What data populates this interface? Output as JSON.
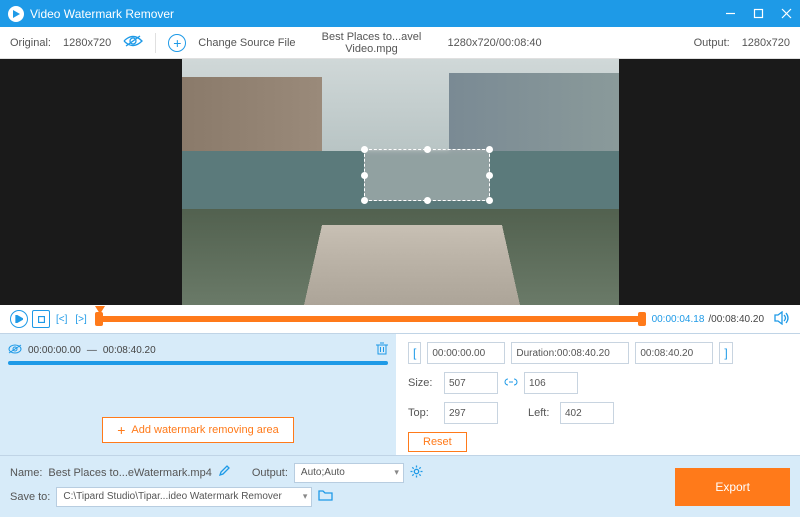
{
  "app": {
    "title": "Video Watermark Remover"
  },
  "toolbar": {
    "original_label": "Original:",
    "original_res": "1280x720",
    "change_source": "Change Source File",
    "filename": "Best Places to...avel Video.mpg",
    "file_meta": "1280x720/00:08:40",
    "output_label": "Output:",
    "output_res": "1280x720"
  },
  "timeline": {
    "skip_back": "[<]",
    "skip_fwd": "[>]",
    "current": "00:00:04.18",
    "duration": "00:08:40.20"
  },
  "segment": {
    "start": "00:00:00.00",
    "sep": "—",
    "end": "00:08:40.20",
    "add_label": "Add watermark removing area"
  },
  "params": {
    "range_start": "00:00:00.00",
    "duration_label": "Duration:",
    "duration_val": "00:08:40.20",
    "range_end": "00:08:40.20",
    "size_label": "Size:",
    "size_w": "507",
    "size_h": "106",
    "top_label": "Top:",
    "top_val": "297",
    "left_label": "Left:",
    "left_val": "402",
    "reset": "Reset"
  },
  "bottom": {
    "name_label": "Name:",
    "name_val": "Best Places to...eWatermark.mp4",
    "output_label": "Output:",
    "output_val": "Auto;Auto",
    "save_label": "Save to:",
    "save_path": "C:\\Tipard Studio\\Tipar...ideo Watermark Remover",
    "export": "Export"
  }
}
